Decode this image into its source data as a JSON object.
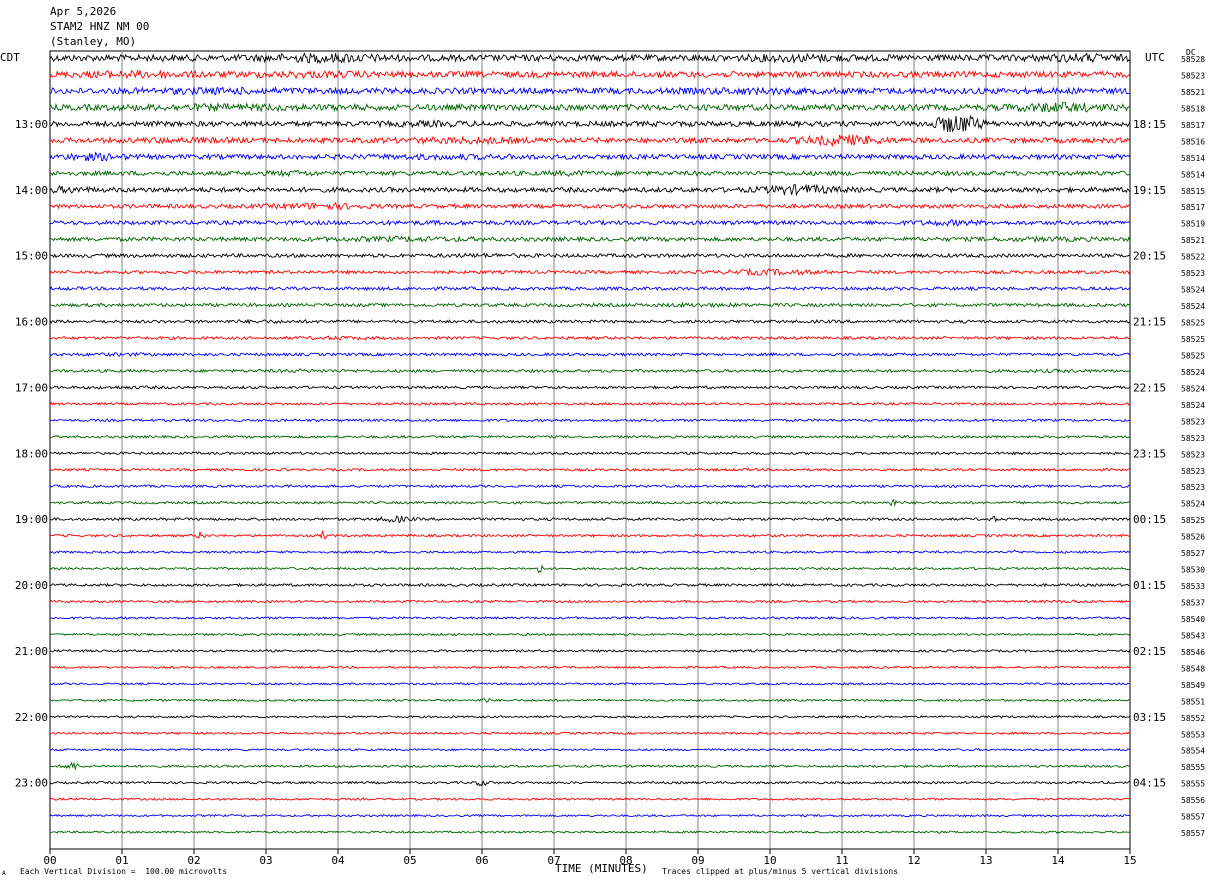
{
  "header": {
    "date": "Apr 5,2026",
    "station": "STAM2 HNZ NM 00",
    "location": "(Stanley, MO)"
  },
  "corner_left": "CDT",
  "corner_right": "UTC",
  "corner_dc": "DC",
  "footer": {
    "scale_note": "Each Vertical Division =  100.00 microvolts",
    "clip_note": "Traces clipped at plus/minus 5 vertical divisions",
    "mark": "A"
  },
  "colors": {
    "trace_cycle": [
      "#000000",
      "#ff0000",
      "#0000ff",
      "#006400"
    ],
    "grid": "#808080"
  },
  "chart_data": {
    "type": "line",
    "title": "",
    "xlabel": "TIME (MINUTES)",
    "ylabel": "",
    "xlim": [
      0,
      15
    ],
    "x_ticks": [
      "00",
      "01",
      "02",
      "03",
      "04",
      "05",
      "06",
      "07",
      "08",
      "09",
      "10",
      "11",
      "12",
      "13",
      "14",
      "15"
    ],
    "grid": true,
    "trace_minutes": 15,
    "local_time_labels": [
      {
        "trace": 4,
        "label": "13:00"
      },
      {
        "trace": 8,
        "label": "14:00"
      },
      {
        "trace": 12,
        "label": "15:00"
      },
      {
        "trace": 16,
        "label": "16:00"
      },
      {
        "trace": 20,
        "label": "17:00"
      },
      {
        "trace": 24,
        "label": "18:00"
      },
      {
        "trace": 28,
        "label": "19:00"
      },
      {
        "trace": 32,
        "label": "20:00"
      },
      {
        "trace": 36,
        "label": "21:00"
      },
      {
        "trace": 40,
        "label": "22:00"
      },
      {
        "trace": 44,
        "label": "23:00"
      }
    ],
    "utc_labels": [
      {
        "trace": 4,
        "label": "18:15"
      },
      {
        "trace": 8,
        "label": "19:15"
      },
      {
        "trace": 12,
        "label": "20:15"
      },
      {
        "trace": 16,
        "label": "21:15"
      },
      {
        "trace": 20,
        "label": "22:15"
      },
      {
        "trace": 24,
        "label": "23:15"
      },
      {
        "trace": 28,
        "label": "00:15"
      },
      {
        "trace": 32,
        "label": "01:15"
      },
      {
        "trace": 36,
        "label": "02:15"
      },
      {
        "trace": 40,
        "label": "03:15"
      },
      {
        "trace": 44,
        "label": "04:15"
      }
    ],
    "dc_offsets": [
      "58528",
      "58523",
      "58521",
      "58518",
      "58517",
      "58516",
      "58514",
      "58514",
      "58515",
      "58517",
      "58519",
      "58521",
      "58522",
      "58523",
      "58524",
      "58524",
      "58525",
      "58525",
      "58525",
      "58524",
      "58524",
      "58524",
      "58523",
      "58523",
      "58523",
      "58523",
      "58523",
      "58524",
      "58525",
      "58526",
      "58527",
      "58530",
      "58533",
      "58537",
      "58540",
      "58543",
      "58546",
      "58548",
      "58549",
      "58551",
      "58552",
      "58553",
      "58554",
      "58555",
      "58555",
      "58556",
      "58557",
      "58557"
    ],
    "traces": [
      {
        "amp": 3.2,
        "events": [
          [
            3.8,
            0.8,
            1.6
          ],
          [
            10.4,
            0.7,
            1.4
          ],
          [
            14.3,
            0.5,
            1.5
          ]
        ]
      },
      {
        "amp": 3.0,
        "events": [
          [
            1.2,
            0.8,
            1.4
          ],
          [
            3.6,
            0.7,
            1.3
          ]
        ]
      },
      {
        "amp": 3.0,
        "events": [
          [
            2.4,
            1.0,
            1.3
          ],
          [
            9.7,
            0.8,
            1.3
          ]
        ]
      },
      {
        "amp": 3.0,
        "events": [
          [
            2.5,
            1.2,
            1.3
          ],
          [
            14.0,
            0.6,
            1.8
          ]
        ]
      },
      {
        "amp": 2.6,
        "events": [
          [
            12.6,
            0.3,
            4.0
          ],
          [
            5.3,
            0.6,
            1.3
          ]
        ]
      },
      {
        "amp": 2.5,
        "events": [
          [
            5.8,
            0.8,
            1.5
          ],
          [
            11.0,
            0.5,
            2.4
          ],
          [
            1.8,
            0.6,
            1.3
          ]
        ]
      },
      {
        "amp": 2.4,
        "events": [
          [
            0.6,
            0.4,
            1.8
          ],
          [
            5.5,
            1.0,
            1.3
          ]
        ]
      },
      {
        "amp": 2.2,
        "events": [
          [
            3.4,
            0.3,
            1.5
          ],
          [
            7.2,
            0.3,
            1.4
          ]
        ]
      },
      {
        "amp": 2.4,
        "events": [
          [
            10.4,
            0.5,
            2.2
          ],
          [
            0.2,
            0.3,
            1.6
          ]
        ]
      },
      {
        "amp": 2.0,
        "events": [
          [
            3.8,
            0.6,
            1.8
          ]
        ]
      },
      {
        "amp": 2.0,
        "events": [
          [
            12.5,
            0.5,
            1.6
          ],
          [
            5.5,
            0.8,
            1.2
          ]
        ]
      },
      {
        "amp": 2.0,
        "events": [
          [
            4.9,
            1.2,
            1.4
          ],
          [
            13.8,
            0.8,
            1.3
          ]
        ]
      },
      {
        "amp": 1.8,
        "events": [
          [
            6.0,
            0.5,
            1.3
          ]
        ]
      },
      {
        "amp": 1.6,
        "events": [
          [
            10.0,
            0.6,
            2.0
          ]
        ]
      },
      {
        "amp": 1.6,
        "events": []
      },
      {
        "amp": 1.6,
        "events": [
          [
            9.0,
            0.6,
            1.4
          ]
        ]
      },
      {
        "amp": 1.5,
        "events": [
          [
            3.0,
            0.5,
            1.3
          ]
        ]
      },
      {
        "amp": 1.4,
        "events": [
          [
            4.0,
            0.5,
            1.4
          ]
        ]
      },
      {
        "amp": 1.4,
        "events": [
          [
            1.0,
            0.5,
            1.3
          ]
        ]
      },
      {
        "amp": 1.4,
        "events": [
          [
            3.5,
            0.6,
            1.4
          ],
          [
            14.0,
            0.6,
            1.3
          ]
        ]
      },
      {
        "amp": 1.3,
        "events": [
          [
            1.0,
            0.5,
            1.3
          ]
        ]
      },
      {
        "amp": 1.2,
        "events": []
      },
      {
        "amp": 1.2,
        "events": []
      },
      {
        "amp": 1.2,
        "events": []
      },
      {
        "amp": 1.2,
        "events": []
      },
      {
        "amp": 1.2,
        "events": []
      },
      {
        "amp": 1.2,
        "events": []
      },
      {
        "amp": 1.2,
        "events": [
          [
            11.7,
            0.05,
            4.0
          ]
        ]
      },
      {
        "amp": 1.3,
        "events": [
          [
            4.8,
            0.2,
            2.8
          ],
          [
            13.1,
            0.05,
            2.5
          ]
        ]
      },
      {
        "amp": 1.2,
        "events": [
          [
            2.1,
            0.05,
            3.5
          ],
          [
            3.8,
            0.03,
            5.0
          ]
        ]
      },
      {
        "amp": 1.1,
        "events": [
          [
            13.4,
            0.03,
            3.0
          ]
        ]
      },
      {
        "amp": 1.1,
        "events": [
          [
            6.8,
            0.03,
            7.0
          ]
        ]
      },
      {
        "amp": 1.3,
        "events": []
      },
      {
        "amp": 1.1,
        "events": [
          [
            14.2,
            0.2,
            1.6
          ]
        ]
      },
      {
        "amp": 1.1,
        "events": []
      },
      {
        "amp": 1.0,
        "events": []
      },
      {
        "amp": 1.1,
        "events": []
      },
      {
        "amp": 1.0,
        "events": []
      },
      {
        "amp": 1.0,
        "events": []
      },
      {
        "amp": 1.0,
        "events": [
          [
            6.05,
            0.05,
            3.5
          ]
        ]
      },
      {
        "amp": 1.0,
        "events": []
      },
      {
        "amp": 1.0,
        "events": []
      },
      {
        "amp": 1.0,
        "events": []
      },
      {
        "amp": 1.1,
        "events": [
          [
            0.3,
            0.1,
            4.0
          ]
        ]
      },
      {
        "amp": 1.1,
        "events": [
          [
            6.0,
            0.1,
            3.0
          ]
        ]
      },
      {
        "amp": 1.0,
        "events": []
      },
      {
        "amp": 1.0,
        "events": []
      },
      {
        "amp": 1.0,
        "events": []
      }
    ]
  }
}
